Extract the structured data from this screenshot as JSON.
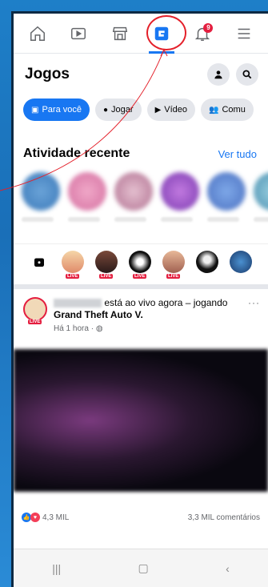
{
  "nav": {
    "icons": [
      "home-icon",
      "watch-icon",
      "marketplace-icon",
      "gaming-icon",
      "notifications-icon",
      "menu-icon"
    ],
    "notification_count": "9"
  },
  "header": {
    "title": "Jogos"
  },
  "chips": [
    {
      "label": "Para você",
      "icon": "gaming-icon"
    },
    {
      "label": "Jogar",
      "icon": "controller-icon"
    },
    {
      "label": "Vídeo",
      "icon": "play-icon"
    },
    {
      "label": "Comu",
      "icon": "people-icon"
    }
  ],
  "activity": {
    "title": "Atividade recente",
    "link": "Ver tudo"
  },
  "live_tag": "LIVE",
  "post": {
    "status_text": "está ao vivo agora – jogando",
    "game": "Grand Theft Auto V.",
    "time": "Há 1 hora · ",
    "more": "···"
  },
  "reactions": {
    "count": "4,3 MIL",
    "comments": "3,3 MIL comentários"
  },
  "colors": {
    "accent": "#1877f2",
    "live": "#e41e3f",
    "annotation": "#e4202a"
  }
}
